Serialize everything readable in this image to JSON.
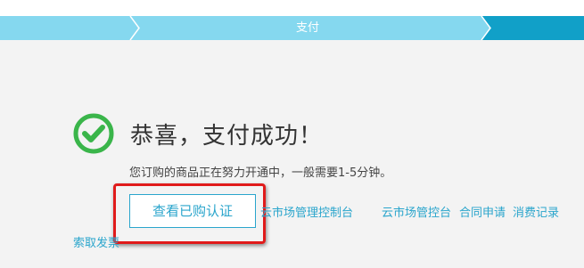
{
  "steps": {
    "current_label": "支付"
  },
  "result": {
    "title": "恭喜，支付成功！",
    "message": "您订购的商品正在努力开通中，一般需要1-5分钟。"
  },
  "actions": {
    "primary_button": "查看已购认证",
    "link_console": "云市场管理控制台",
    "link_market": "云市场管控台",
    "link_contract": "合同申请",
    "link_records": "消费记录",
    "link_invoice": "索取发票"
  },
  "colors": {
    "step_light": "#85d8ef",
    "step_dark": "#11a0c8",
    "success_green": "#3ab54a",
    "link_blue": "#2aa5cc",
    "highlight_red": "#e01b1b"
  },
  "icons": {
    "success": "check-circle-icon"
  }
}
